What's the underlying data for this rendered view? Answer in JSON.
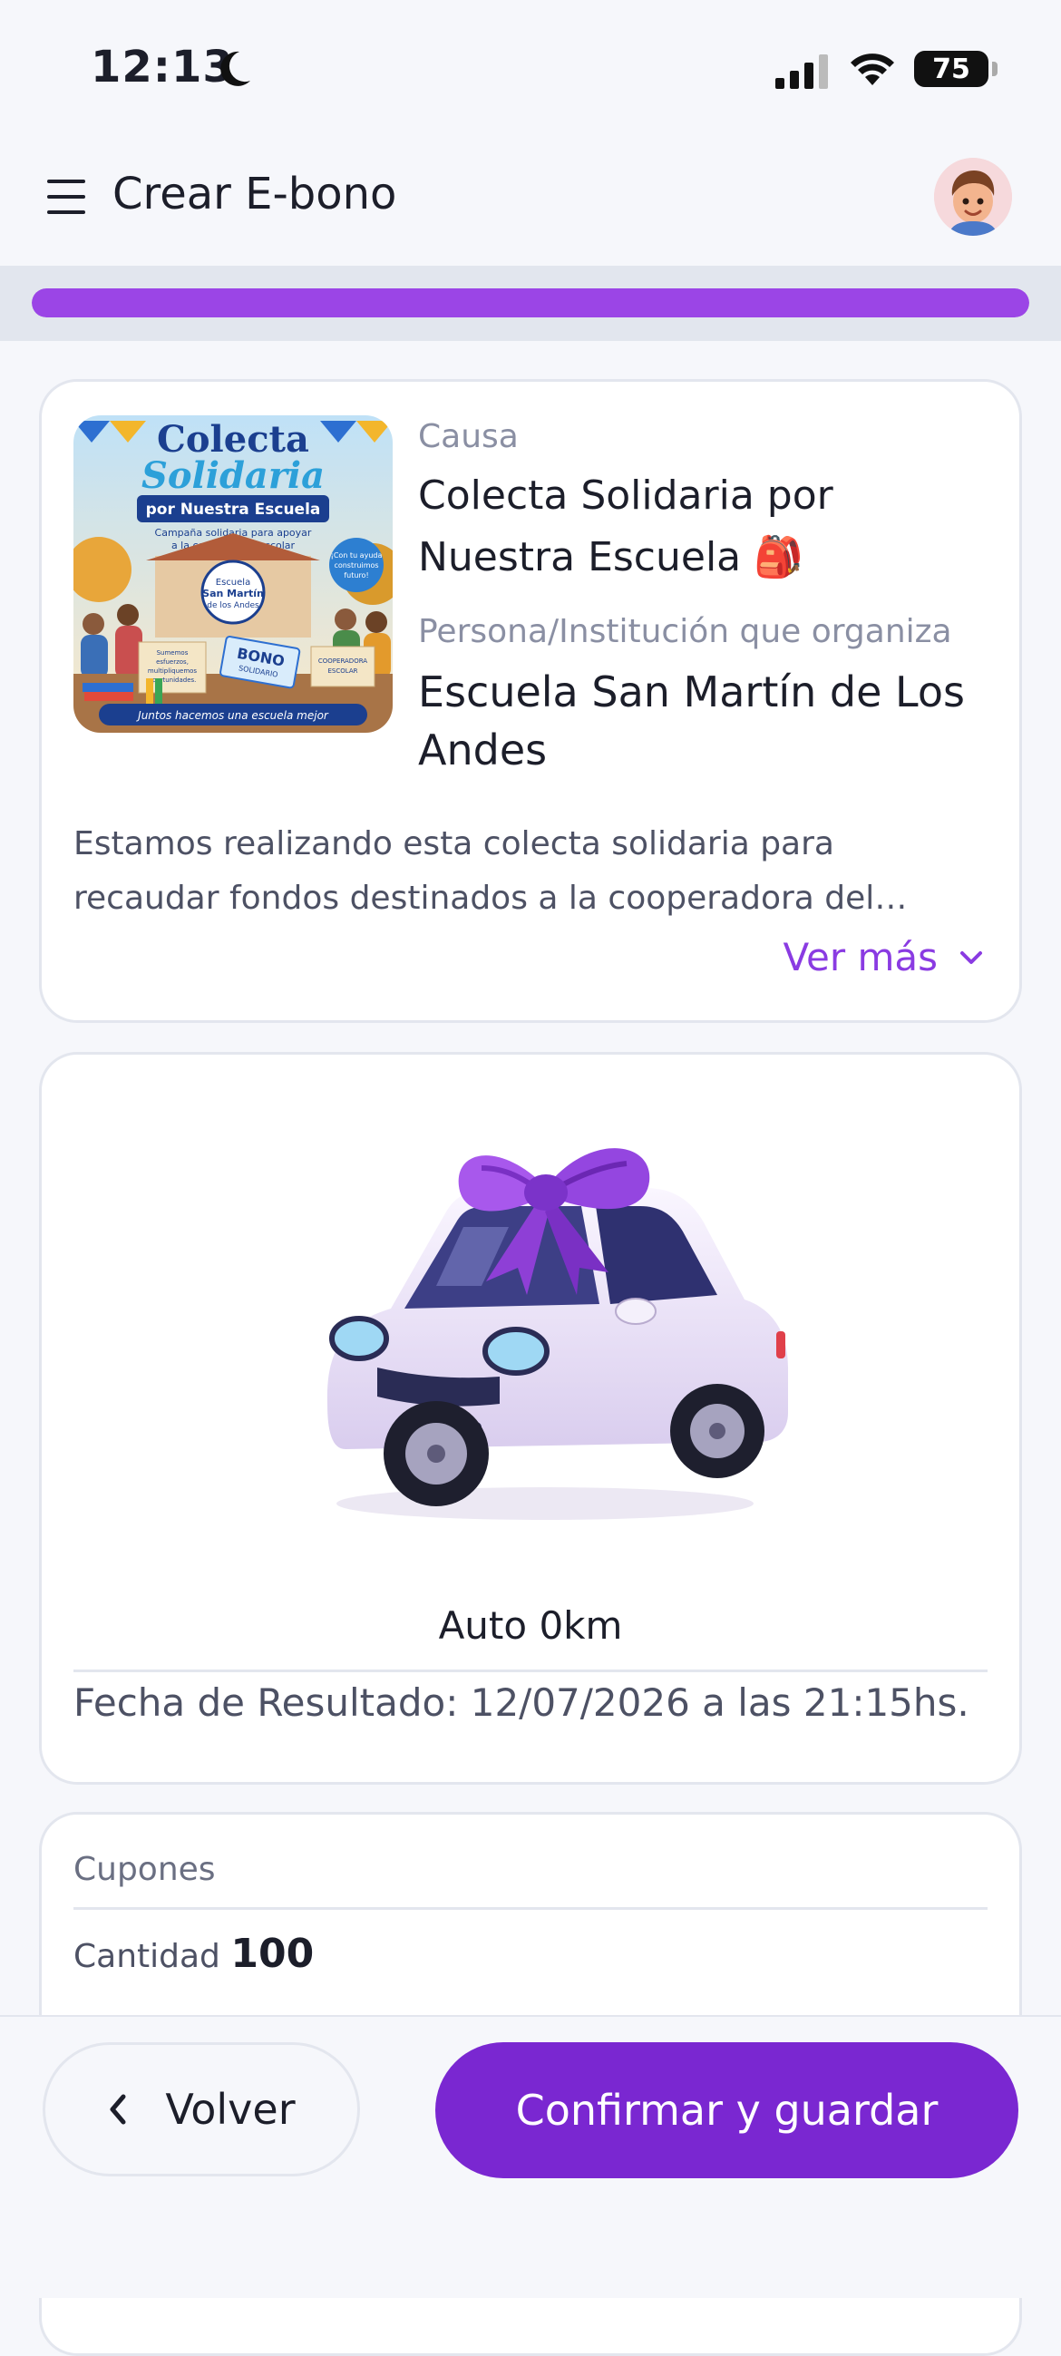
{
  "status_bar": {
    "time": "12:13",
    "battery": "75"
  },
  "header": {
    "title": "Crear E-bono"
  },
  "progress": {
    "value": 1.0,
    "color": "#9b45e6"
  },
  "cause": {
    "label": "Causa",
    "title": "Colecta Solidaria por Nuestra Escuela 🎒",
    "organizer_label": "Persona/Institución que organiza",
    "organizer": "Escuela San Martín de Los Andes",
    "description": "Estamos realizando esta colecta solidaria para recaudar fondos destinados a la cooperadora del colegio…",
    "more_label": "Ver más",
    "poster": {
      "line1": "Colecta",
      "line2": "Solidaria",
      "line3": "por Nuestra Escuela",
      "subtitle1": "Campaña solidaria para apoyar",
      "subtitle2": "a la cooperadora escolar",
      "school1": "Escuela",
      "school2": "San Martín",
      "school3": "de los Andes",
      "help1": "¡Con tu ayuda",
      "help2": "construimos",
      "help3": "futuro!",
      "card1": "Sumemos",
      "card2": "esfuerzos,",
      "card3": "multipliquemos",
      "card4": "oportunidades.",
      "bono1": "BONO",
      "bono2": "SOLIDARIO",
      "coop1": "COOPERADORA",
      "coop2": "ESCOLAR",
      "footer": "Juntos hacemos una escuela mejor"
    }
  },
  "prize": {
    "name": "Auto 0km",
    "result_date": "Fecha de Resultado: 12/07/2026 a las 21:15hs."
  },
  "coupons": {
    "label": "Cupones",
    "quantity_label": "Cantidad",
    "quantity": "100"
  },
  "actions": {
    "back_label": "Volver",
    "confirm_label": "Confirmar y guardar"
  },
  "colors": {
    "accent": "#7a27d1",
    "accent_light": "#9b45e6"
  }
}
